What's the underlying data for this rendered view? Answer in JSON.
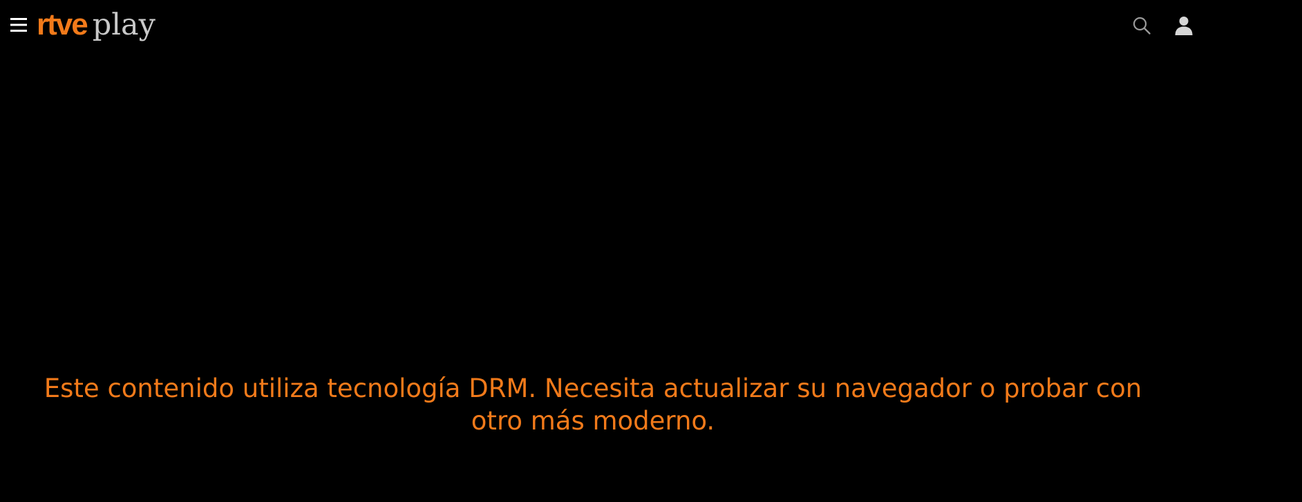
{
  "header": {
    "logo": {
      "brand": "rtve",
      "product": "play"
    },
    "icons": {
      "menu": "hamburger-menu-icon",
      "search": "search-icon",
      "user": "user-icon"
    }
  },
  "player": {
    "message": "Este contenido utiliza tecnología DRM. Necesita actualizar su navegador o probar con otro más moderno."
  },
  "colors": {
    "background": "#000000",
    "brand_orange": "#f27a1a",
    "logo_grey": "#c9c9c9",
    "icon_grey": "#9a9a9a",
    "icon_light": "#ffffff"
  }
}
